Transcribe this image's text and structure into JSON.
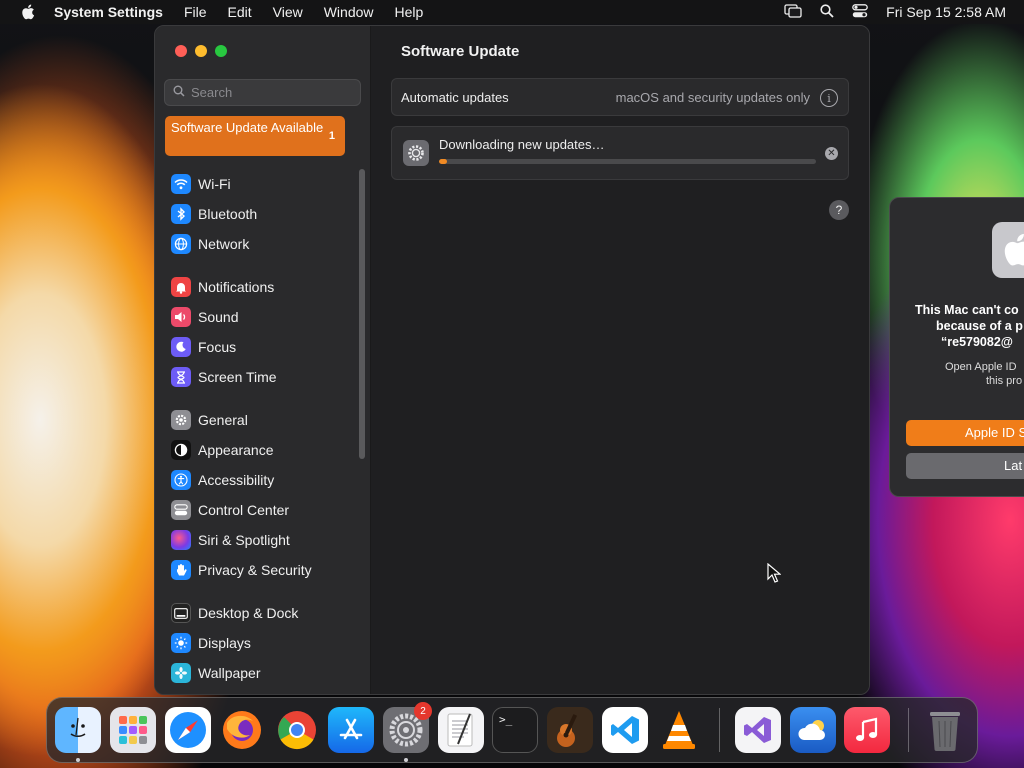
{
  "menubar": {
    "app_name": "System Settings",
    "menus": [
      "File",
      "Edit",
      "View",
      "Window",
      "Help"
    ],
    "clock": "Fri Sep 15  2:58 AM"
  },
  "sidebar": {
    "search_placeholder": "Search",
    "update_banner": {
      "label": "Software Update Available",
      "badge": "1"
    },
    "items": [
      {
        "label": "Wi-Fi",
        "icon": "wifi-icon",
        "color": "#1e88ff"
      },
      {
        "label": "Bluetooth",
        "icon": "bluetooth-icon",
        "color": "#1e88ff"
      },
      {
        "label": "Network",
        "icon": "globe-icon",
        "color": "#1e88ff"
      },
      {
        "label": "Notifications",
        "icon": "bell-icon",
        "color": "#ef4444"
      },
      {
        "label": "Sound",
        "icon": "speaker-icon",
        "color": "#ec4a6a"
      },
      {
        "label": "Focus",
        "icon": "moon-icon",
        "color": "#6d5cf6"
      },
      {
        "label": "Screen Time",
        "icon": "hourglass-icon",
        "color": "#6d5cf6"
      },
      {
        "label": "General",
        "icon": "gear-icon",
        "color": "#8e8e93"
      },
      {
        "label": "Appearance",
        "icon": "appearance-icon",
        "color": "#111111"
      },
      {
        "label": "Accessibility",
        "icon": "accessibility-icon",
        "color": "#1e88ff"
      },
      {
        "label": "Control Center",
        "icon": "control-center-icon",
        "color": "#8e8e93"
      },
      {
        "label": "Siri & Spotlight",
        "icon": "siri-icon",
        "color": "#b03ad6"
      },
      {
        "label": "Privacy & Security",
        "icon": "hand-icon",
        "color": "#1e88ff"
      },
      {
        "label": "Desktop & Dock",
        "icon": "dock-icon",
        "color": "#222222"
      },
      {
        "label": "Displays",
        "icon": "sun-icon",
        "color": "#1e88ff"
      },
      {
        "label": "Wallpaper",
        "icon": "wallpaper-icon",
        "color": "#2bb5d9"
      }
    ]
  },
  "content": {
    "title": "Software Update",
    "auto_updates": {
      "label": "Automatic updates",
      "value": "macOS and security updates only"
    },
    "download": {
      "label": "Downloading new updates…",
      "progress": 0.02
    }
  },
  "dialog": {
    "message_line1": "This Mac can't co",
    "message_line2": "because of a p",
    "message_line3": "“re579082@",
    "sub_line1": "Open Apple ID",
    "sub_line2": "this pro",
    "primary_button": "Apple ID S",
    "secondary_button": "Lat"
  },
  "dock": {
    "apps": [
      {
        "name": "Finder",
        "icon": "finder-icon",
        "color": "#3aa0f5",
        "running": true
      },
      {
        "name": "Launchpad",
        "icon": "launchpad-icon",
        "color": "#e5e5ea",
        "running": false
      },
      {
        "name": "Safari",
        "icon": "safari-icon",
        "color": "#1e90ff",
        "running": false
      },
      {
        "name": "Firefox",
        "icon": "firefox-icon",
        "color": "#ff7a1a",
        "running": false
      },
      {
        "name": "Chrome",
        "icon": "chrome-icon",
        "color": "#ffffff",
        "running": false
      },
      {
        "name": "App Store",
        "icon": "app-store-icon",
        "color": "#1d8cf8",
        "running": false
      },
      {
        "name": "System Settings",
        "icon": "system-settings-icon",
        "color": "#8e8e93",
        "running": true,
        "badge": "2"
      },
      {
        "name": "TextEdit",
        "icon": "textedit-icon",
        "color": "#f2f2f2",
        "running": false
      },
      {
        "name": "Terminal",
        "icon": "terminal-icon",
        "color": "#1c1c1e",
        "running": false
      },
      {
        "name": "GarageBand",
        "icon": "garageband-icon",
        "color": "#3a2a1c",
        "running": false
      },
      {
        "name": "VS Code",
        "icon": "vscode-icon",
        "color": "#ffffff",
        "running": false
      },
      {
        "name": "VLC",
        "icon": "vlc-icon",
        "color": "#ff8800",
        "running": false
      },
      {
        "name": "Visual Studio",
        "icon": "visual-studio-icon",
        "color": "#f4f4f6",
        "running": false
      },
      {
        "name": "Weather",
        "icon": "weather-icon",
        "color": "#2b7de9",
        "running": false
      },
      {
        "name": "Music",
        "icon": "music-icon",
        "color": "#fa3c50",
        "running": false
      },
      {
        "name": "Trash",
        "icon": "trash-icon",
        "color": "#5a5a5e",
        "running": false
      }
    ]
  }
}
